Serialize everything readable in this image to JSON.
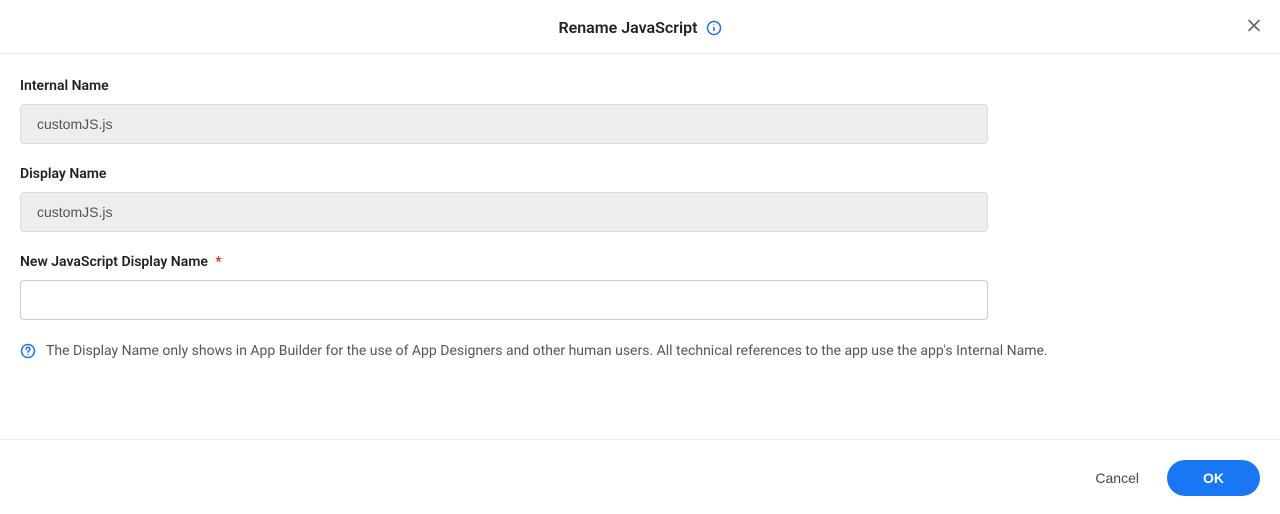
{
  "dialog": {
    "title": "Rename JavaScript",
    "close_aria": "Close"
  },
  "fields": {
    "internal_name": {
      "label": "Internal Name",
      "value": "customJS.js"
    },
    "display_name": {
      "label": "Display Name",
      "value": "customJS.js"
    },
    "new_display_name": {
      "label": "New JavaScript Display Name",
      "value": ""
    }
  },
  "help": {
    "text": "The Display Name only shows in App Builder for the use of App Designers and other human users. All technical references to the app use the app's Internal Name."
  },
  "footer": {
    "cancel": "Cancel",
    "ok": "OK"
  }
}
